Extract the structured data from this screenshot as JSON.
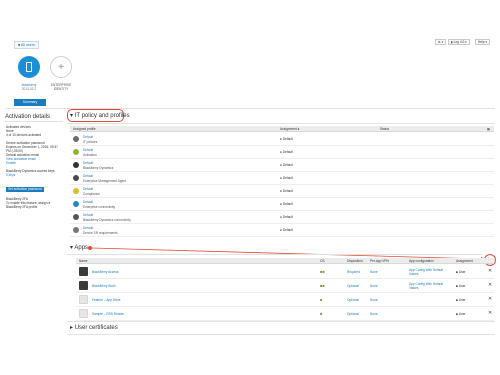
{
  "header": {
    "all_users": "All users",
    "gear": "⚙ ▾",
    "user": "▮ Log 4.0 ▾",
    "help": "Help ▾"
  },
  "devices": {
    "device_label": "blackberry",
    "device_sub": "2013-03-2",
    "add_label": "ENTERPRISE",
    "add_sub": "IDENTITY",
    "summary": "Summary"
  },
  "activation": {
    "title": "Activation details",
    "lines": [
      {
        "text": "Activated devices",
        "link": false
      },
      {
        "text": "None",
        "link": false
      },
      {
        "text": "4 of 10 devices activated",
        "link": false
      },
      {
        "text": "",
        "link": false
      },
      {
        "text": "Device activation password",
        "link": false
      },
      {
        "text": "Expires on December 1, 2016, 09:37",
        "link": false
      },
      {
        "text": "PM (-05:00)",
        "link": false
      },
      {
        "text": "Default activation email",
        "link": false
      },
      {
        "text": "View activation email",
        "link": true
      },
      {
        "text": "Enable",
        "link": true
      },
      {
        "text": "",
        "link": false
      },
      {
        "text": "BlackBerry Dynamics access keys",
        "link": false
      },
      {
        "text": "0 keys",
        "link": true
      }
    ],
    "set_password": "Set activation password",
    "bbra_lines": [
      {
        "text": "BlackBerry 2FA",
        "link": false
      },
      {
        "text": "To enable this feature, assign a",
        "link": false
      },
      {
        "text": "BlackBerry 2FA profile",
        "link": false
      }
    ]
  },
  "policies": {
    "title": "IT policy and profiles",
    "columns": [
      "Assigned profile",
      "Assignment",
      "Status"
    ],
    "rows": [
      {
        "name": "Default",
        "type": "IT policies",
        "assignment": "Default",
        "color": "#6d6d6d"
      },
      {
        "name": "Default",
        "type": "Activation",
        "assignment": "Default",
        "color": "#8ab534"
      },
      {
        "name": "Default",
        "type": "BlackBerry Dynamics",
        "assignment": "Default",
        "color": "#333333"
      },
      {
        "name": "Default",
        "type": "Enterprise Management Agent",
        "assignment": "Default",
        "color": "#4a4a4a"
      },
      {
        "name": "Default",
        "type": "Compliance",
        "assignment": "Default",
        "color": "#e3b928"
      },
      {
        "name": "Default",
        "type": "Enterprise connectivity",
        "assignment": "Default",
        "color": "#2a86c8"
      },
      {
        "name": "Default",
        "type": "BlackBerry Dynamics connectivity",
        "assignment": "Default",
        "color": "#555555"
      },
      {
        "name": "Default",
        "type": "Device SR requirements",
        "assignment": "Default",
        "color": "#777777"
      }
    ]
  },
  "apps": {
    "title": "Apps",
    "columns": [
      "Name",
      "OS",
      "Disposition",
      "Per-app VPN",
      "App configuration",
      "Assignment"
    ],
    "rows": [
      {
        "name": "BlackBerry Access",
        "os_glyph": "■■",
        "disposition": "Required",
        "vpn": "None",
        "config": "App Config With Default Values",
        "assign": "User",
        "dark": true
      },
      {
        "name": "BlackBerry Work",
        "os_glyph": "■■",
        "disposition": "Optional",
        "vpn": "None",
        "config": "App Config With Default Values",
        "assign": "User",
        "dark": true
      },
      {
        "name": "Feature – App Store",
        "os_glyph": "■",
        "disposition": "Optional",
        "vpn": "None",
        "config": "",
        "assign": "User",
        "dark": false
      },
      {
        "name": "Sample – RSS Reader",
        "os_glyph": "■",
        "disposition": "Optional",
        "vpn": "None",
        "config": "",
        "assign": "User",
        "dark": false
      }
    ],
    "add": "+"
  },
  "certificates": {
    "title": "User certificates"
  },
  "colors": {
    "accent": "#1a7bbf",
    "callout": "#e04a35"
  }
}
